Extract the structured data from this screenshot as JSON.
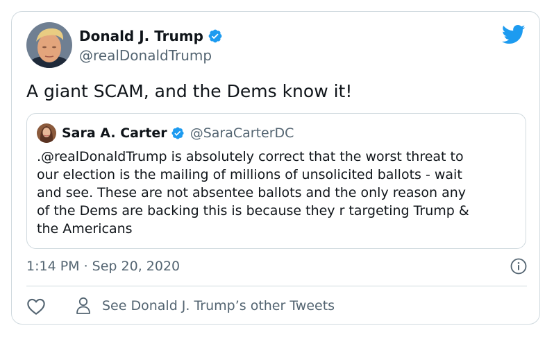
{
  "author": {
    "name": "Donald J. Trump",
    "handle": "@realDonaldTrump"
  },
  "tweet": {
    "text": "A giant SCAM, and the Dems know it!",
    "timestamp": "1:14 PM · Sep 20, 2020"
  },
  "quoted_tweet": {
    "name": "Sara A. Carter",
    "handle": "@SaraCarterDC",
    "lines": [
      ".@realDonaldTrump is absolutely correct that the worst threat to",
      "our election is the mailing of millions of unsolicited ballots - wait",
      "and see. These are not absentee ballots and the only reason any",
      "of the Dems are backing this is because they r targeting Trump &",
      "the Americans"
    ]
  },
  "actions": {
    "other_tweets_label": "See Donald J. Trump’s other Tweets"
  },
  "icons": {
    "brand": "twitter-bird-icon",
    "verified": "verified-badge-icon",
    "info": "info-icon",
    "like": "heart-icon",
    "person": "person-icon"
  },
  "colors": {
    "brand_blue": "#1d9bf0",
    "text_primary": "#0f1419",
    "text_secondary": "#536471",
    "border": "#cfd9de"
  }
}
